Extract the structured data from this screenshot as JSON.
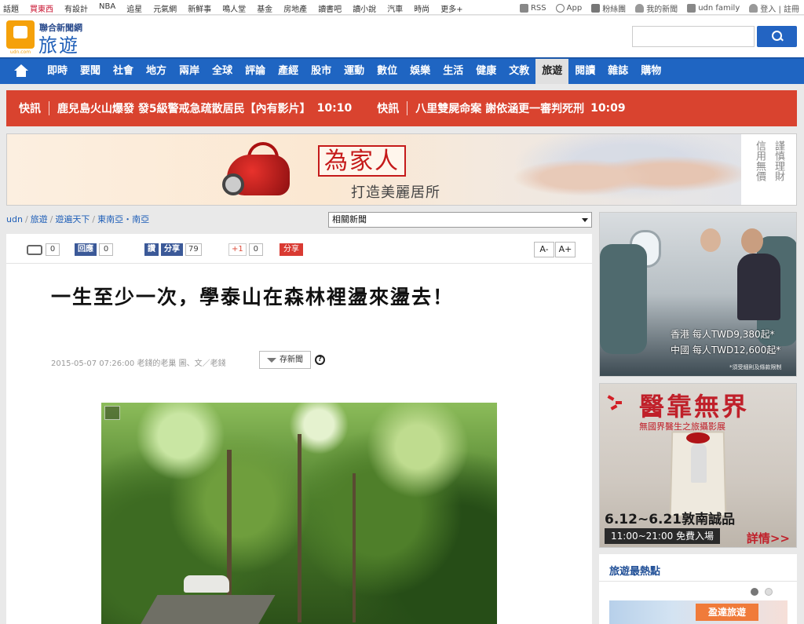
{
  "topbar": {
    "links": [
      "話題",
      "買東西",
      "有設計",
      "NBA",
      "追星",
      "元氣網",
      "新鮮事",
      "鳴人堂",
      "基金",
      "房地產",
      "讀書吧",
      "讀小說",
      "汽車",
      "時尚",
      "更多+"
    ],
    "right": [
      "RSS",
      "App",
      "粉絲團",
      "我的新聞",
      "udn family",
      "登入 | 註冊"
    ]
  },
  "header": {
    "logo_sub": "聯合新聞網",
    "logo_title": "旅遊",
    "logo_small": "udn.com",
    "search_value": ""
  },
  "nav": {
    "items": [
      "即時",
      "要聞",
      "社會",
      "地方",
      "兩岸",
      "全球",
      "評論",
      "產經",
      "股市",
      "運動",
      "數位",
      "娛樂",
      "生活",
      "健康",
      "文教",
      "旅遊",
      "閱讀",
      "雜誌",
      "購物"
    ],
    "active": "旅遊"
  },
  "breaking": [
    {
      "label": "快訊",
      "text": "鹿兒島火山爆發 發5級警戒急疏散居民【內有影片】",
      "time": "10:10"
    },
    {
      "label": "快訊",
      "text": "八里雙屍命案 謝依涵更一審判死刑",
      "time": "10:09"
    }
  ],
  "ad_banner": {
    "slogan": "為家人",
    "tagline": "打造美麗居所",
    "brand_right": [
      "信",
      "用",
      "無",
      "價",
      "謹",
      "慎",
      "理",
      "財"
    ]
  },
  "breadcrumb": [
    "udn",
    "旅遊",
    "遊遍天下",
    "東南亞・南亞"
  ],
  "related_select": "相關新聞",
  "toolbar": {
    "comments": "0",
    "fb_recommend_label": "回應",
    "fb_recommend_count": "0",
    "fb_like_label": "讚",
    "fb_share_label": "分享",
    "fb_share_count": "79",
    "gplus_label": "+1",
    "gplus_count": "0",
    "share_label": "分享",
    "font_minus": "A-",
    "font_plus": "A+"
  },
  "article": {
    "headline": "一生至少一次，學泰山在森林裡盪來盪去！",
    "meta": "2015-05-07 07:26:00 老錢的老巢 圖、文／老錢",
    "save_label": "存新聞",
    "help": "?"
  },
  "sidebar": {
    "ad1_price1": "香港 每人TWD9,380起*",
    "ad1_price2": "中國 每人TWD12,600起*",
    "ad1_fine": "*須受細則及條款限制",
    "ad2_title": "醫靠無界",
    "ad2_sub": "無國界醫生之旅攝影展",
    "ad2_dates": "6.12~6.21敦南誠品",
    "ad2_hours": "11:00~21:00 免費入場",
    "ad2_more": "詳情>>",
    "hot_title": "旅遊最熱點",
    "hot_thumb_tag": "盈達旅遊"
  },
  "colors": {
    "nav_blue": "#1f65c2",
    "breaking_red": "#d9432f",
    "logo_orange": "#f5a10a"
  }
}
